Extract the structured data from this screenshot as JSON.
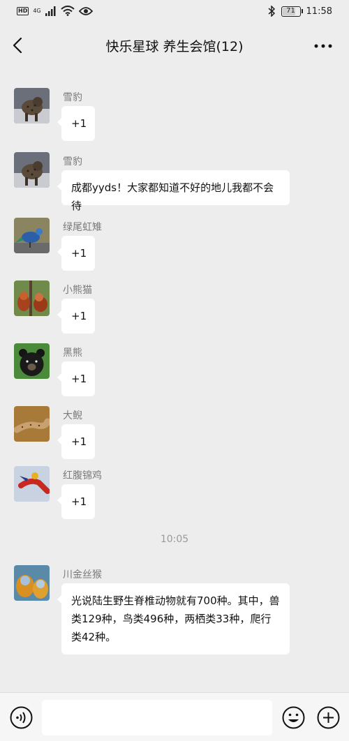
{
  "status_bar": {
    "left": {
      "hd": "HD",
      "network": "4G"
    },
    "battery_level": "71",
    "time": "11:58"
  },
  "nav": {
    "title": "快乐星球  养生会馆(12)"
  },
  "messages": [
    {
      "sender": "雪豹",
      "text": "+1"
    },
    {
      "sender": "雪豹",
      "text": "成都yyds！大家都知道不好的地儿我都不会待"
    },
    {
      "sender": "绿尾虹雉",
      "text": "+1"
    },
    {
      "sender": "小熊猫",
      "text": "+1"
    },
    {
      "sender": "黑熊",
      "text": "+1"
    },
    {
      "sender": "大鲵",
      "text": "+1"
    },
    {
      "sender": "红腹锦鸡",
      "text": "+1"
    },
    {
      "sender": "川金丝猴",
      "text": "光说陆生野生脊椎动物就有700种。其中，兽类129种，鸟类496种，两栖类33种，爬行类42种。"
    }
  ],
  "time_divider": "10:05",
  "input": {
    "value": ""
  }
}
